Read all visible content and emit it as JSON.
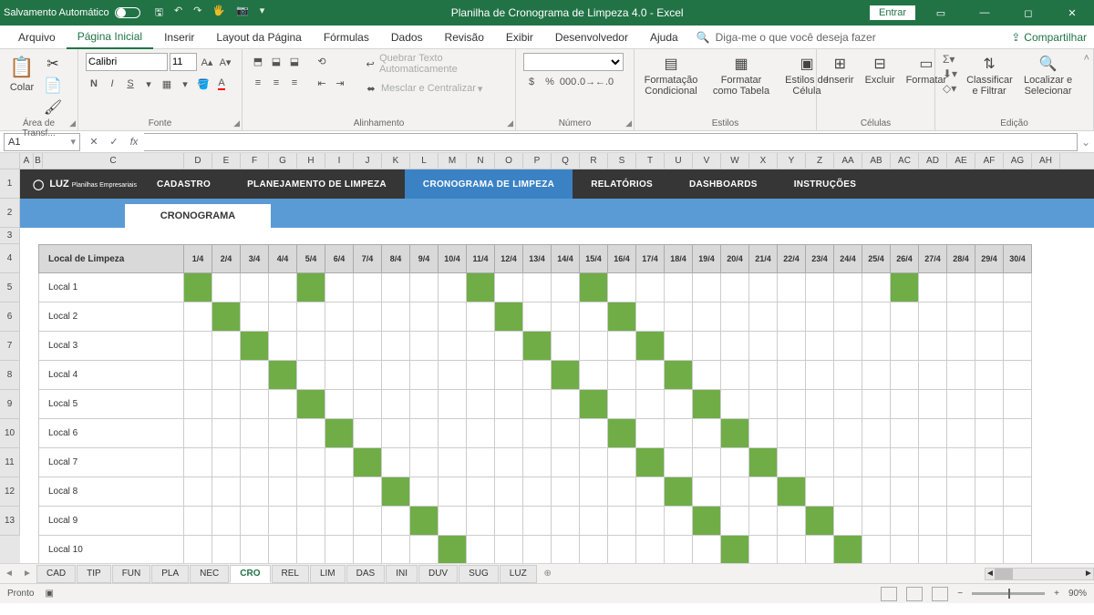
{
  "titlebar": {
    "autosave": "Salvamento Automático",
    "title": "Planilha de Cronograma de Limpeza 4.0  -  Excel",
    "signin": "Entrar"
  },
  "menu": {
    "tabs": [
      "Arquivo",
      "Página Inicial",
      "Inserir",
      "Layout da Página",
      "Fórmulas",
      "Dados",
      "Revisão",
      "Exibir",
      "Desenvolvedor",
      "Ajuda"
    ],
    "active": 1,
    "tell": "Diga-me o que você deseja fazer",
    "share": "Compartilhar"
  },
  "ribbon": {
    "clipboard": {
      "paste": "Colar",
      "label": "Área de Transf..."
    },
    "font": {
      "name": "Calibri",
      "size": "11",
      "label": "Fonte"
    },
    "align": {
      "wrap": "Quebrar Texto Automaticamente",
      "merge": "Mesclar e Centralizar",
      "label": "Alinhamento"
    },
    "number": {
      "label": "Número"
    },
    "styles": {
      "cond": "Formatação Condicional",
      "table": "Formatar como Tabela",
      "cell": "Estilos de Célula",
      "label": "Estilos"
    },
    "cells": {
      "insert": "Inserir",
      "delete": "Excluir",
      "format": "Formatar",
      "label": "Células"
    },
    "editing": {
      "sort": "Classificar e Filtrar",
      "find": "Localizar e Selecionar",
      "label": "Edição"
    }
  },
  "namebox": "A1",
  "colheaders": [
    "A",
    "B",
    "C",
    "D",
    "E",
    "F",
    "G",
    "H",
    "I",
    "J",
    "K",
    "L",
    "M",
    "N",
    "O",
    "P",
    "Q",
    "R",
    "S",
    "T",
    "U",
    "V",
    "W",
    "X",
    "Y",
    "Z",
    "AA",
    "AB",
    "AC",
    "AD",
    "AE",
    "AF",
    "AG",
    "AH"
  ],
  "rowheaders": [
    "1",
    "2",
    "3",
    "4",
    "5",
    "6",
    "7",
    "8",
    "9",
    "10",
    "11",
    "12",
    "13"
  ],
  "nav": {
    "logo": "LUZ",
    "logosub": "Planilhas Empresariais",
    "items": [
      "CADASTRO",
      "PLANEJAMENTO DE LIMPEZA",
      "CRONOGRAMA DE LIMPEZA",
      "RELATÓRIOS",
      "DASHBOARDS",
      "INSTRUÇÕES"
    ],
    "active": 2
  },
  "subtab": "CRONOGRAMA",
  "tableheader": "Local de Limpeza",
  "dates": [
    "1/4",
    "2/4",
    "3/4",
    "4/4",
    "5/4",
    "6/4",
    "7/4",
    "8/4",
    "9/4",
    "10/4",
    "11/4",
    "12/4",
    "13/4",
    "14/4",
    "15/4",
    "16/4",
    "17/4",
    "18/4",
    "19/4",
    "20/4",
    "21/4",
    "22/4",
    "23/4",
    "24/4",
    "25/4",
    "26/4",
    "27/4",
    "28/4",
    "29/4",
    "30/4"
  ],
  "rows": [
    {
      "name": "Local 1",
      "fill": [
        0,
        4,
        10,
        14,
        25
      ]
    },
    {
      "name": "Local 2",
      "fill": [
        1,
        11,
        15
      ]
    },
    {
      "name": "Local 3",
      "fill": [
        2,
        12,
        16
      ]
    },
    {
      "name": "Local 4",
      "fill": [
        3,
        13,
        17
      ]
    },
    {
      "name": "Local 5",
      "fill": [
        4,
        14,
        18
      ]
    },
    {
      "name": "Local 6",
      "fill": [
        5,
        15,
        19
      ]
    },
    {
      "name": "Local 7",
      "fill": [
        6,
        16,
        20
      ]
    },
    {
      "name": "Local 8",
      "fill": [
        7,
        17,
        21
      ]
    },
    {
      "name": "Local 9",
      "fill": [
        8,
        18,
        22
      ]
    },
    {
      "name": "Local 10",
      "fill": [
        9,
        19,
        23
      ]
    }
  ],
  "sheettabs": [
    "CAD",
    "TIP",
    "FUN",
    "PLA",
    "NEC",
    "CRO",
    "REL",
    "LIM",
    "DAS",
    "INI",
    "DUV",
    "SUG",
    "LUZ"
  ],
  "activesheet": 5,
  "status": {
    "ready": "Pronto",
    "zoom": "90%"
  }
}
